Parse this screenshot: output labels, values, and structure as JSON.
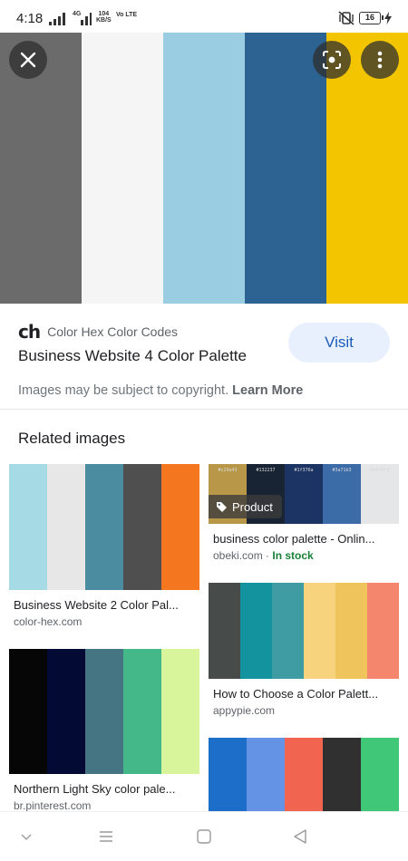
{
  "status_bar": {
    "time": "4:18",
    "network": "4G",
    "speed_value": "104",
    "speed_unit": "KB/S",
    "volte": "Vo LTE",
    "battery": "16"
  },
  "hero": {
    "colors": [
      "#6b6b6b",
      "#f5f5f5",
      "#9acde2",
      "#2c6393",
      "#f2c500"
    ]
  },
  "result": {
    "source_logo": "ch",
    "source_name": "Color Hex Color Codes",
    "title": "Business Website 4 Color Palette",
    "visit_label": "Visit",
    "copyright_text": "Images may be subject to copyright.",
    "learn_more": "Learn More"
  },
  "related": {
    "heading": "Related images",
    "items": [
      {
        "colors": [
          "#a6dbe6",
          "#e7e7e7",
          "#4c8ca1",
          "#4f4f4f",
          "#f4761f"
        ],
        "caption": "Business Website 2 Color Pal...",
        "site": "color-hex.com"
      },
      {
        "colors": [
          "#b89848",
          "#182434",
          "#1c3464",
          "#3c6ca8",
          "#e4e6e8"
        ],
        "hex_labels": [
          "#c29a43",
          "#132237",
          "#1f376a",
          "#3a71b3",
          "#e8f0f3"
        ],
        "badge": "Product",
        "caption": "business color palette - Onlin...",
        "site": "obeki.com",
        "stock": "In stock"
      },
      {
        "colors": [
          "#474c4b",
          "#12939e",
          "#3f9ca2",
          "#f7d37e",
          "#efc45c",
          "#f4866d"
        ],
        "caption": "How to Choose a Color Palett...",
        "site": "appypie.com"
      },
      {
        "colors": [
          "#060606",
          "#030b34",
          "#457482",
          "#44b889",
          "#d8f59c"
        ],
        "caption": "Northern Light Sky color pale...",
        "site": "br.pinterest.com"
      },
      {
        "colors": [
          "#1c6ec8",
          "#6493e6",
          "#f06450",
          "#303030",
          "#40c878"
        ]
      }
    ]
  }
}
